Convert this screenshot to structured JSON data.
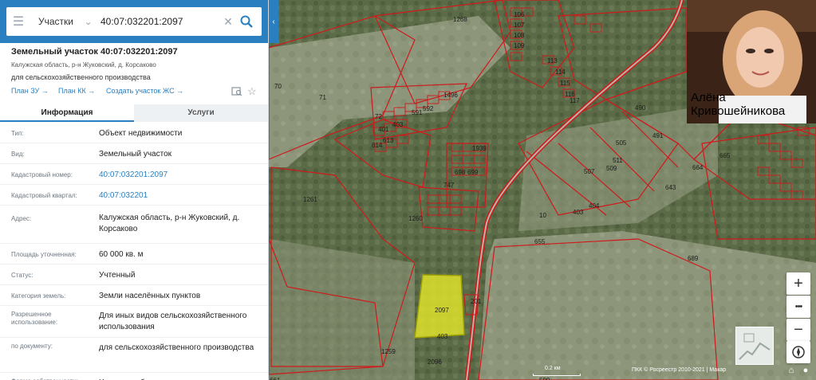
{
  "search": {
    "category": "Участки",
    "query": "40:07:032201:2097"
  },
  "parcel": {
    "title": "Земельный участок 40:07:032201:2097",
    "address_short": "Калужская область, р-н Жуковский, д. Корсаково",
    "purpose": "для сельскохозяйственного производства"
  },
  "links": {
    "plan_zu": "План ЗУ →",
    "plan_kk": "План КК →",
    "create": "Создать участок ЖС →"
  },
  "tabs": {
    "info": "Информация",
    "services": "Услуги"
  },
  "properties": [
    {
      "label": "Тип:",
      "value": "Объект недвижимости",
      "link": false
    },
    {
      "label": "Вид:",
      "value": "Земельный участок",
      "link": false
    },
    {
      "label": "Кадастровый номер:",
      "value": "40:07:032201:2097",
      "link": true
    },
    {
      "label": "Кадастровый квартал:",
      "value": "40:07:032201",
      "link": true
    },
    {
      "label": "Адрес:",
      "value": "Калужская область, р-н Жуковский, д. Корсаково",
      "link": false
    },
    {
      "label": "Площадь уточненная:",
      "value": "60 000 кв. м",
      "link": false
    },
    {
      "label": "Статус:",
      "value": "Учтенный",
      "link": false
    },
    {
      "label": "Категория земель:",
      "value": "Земли населённых пунктов",
      "link": false
    },
    {
      "label": "Разрешенное использование:",
      "value": "Для иных видов сельскохозяйственного использования",
      "link": false
    },
    {
      "label": "по документу:",
      "value": "для сельскохозяйственного производства",
      "link": false
    },
    {
      "label": "Форма собственности:",
      "value": "Частная собственность",
      "link": false
    }
  ],
  "map": {
    "plot_numbers": [
      "1268",
      "106",
      "107",
      "108",
      "109",
      "113",
      "114",
      "115",
      "116",
      "117",
      "70",
      "71",
      "72",
      "1496",
      "592",
      "591",
      "403",
      "401",
      "614",
      "613",
      "1939",
      "698",
      "699",
      "747",
      "1260",
      "1261",
      "10",
      "655",
      "490",
      "505",
      "507",
      "511",
      "509",
      "491",
      "404",
      "403",
      "665",
      "664",
      "643",
      "689",
      "2097",
      "201",
      "403",
      "1259",
      "2096",
      "599",
      "661"
    ],
    "highlighted_parcel": "2097",
    "scale": "0.2 км",
    "copyright": "ПКК © Росреестр 2010-2021 | Макар"
  },
  "overlay": {
    "person_name": "Алёна Кривошейникова"
  },
  "controls": {
    "zoom_in": "+",
    "more": "•••",
    "zoom_out": "−"
  },
  "colors": {
    "brand_blue": "#2a7fc0",
    "parcel_outline": "#d0191b",
    "highlight_fill": "#e6e82a"
  }
}
